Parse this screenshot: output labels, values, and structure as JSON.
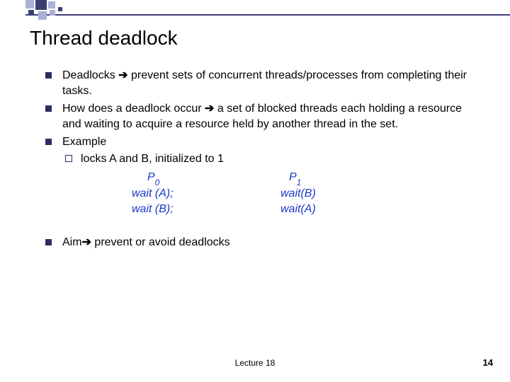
{
  "title": "Thread deadlock",
  "bullets": {
    "b1_a": "Deadlocks ",
    "b1_b": "  prevent sets of concurrent threads/processes from completing their tasks.",
    "b2_a": "How does a deadlock occur ",
    "b2_b": " a set of blocked threads each holding a resource and waiting to acquire a resource held by another thread in the set.",
    "b3": "Example",
    "b3_sub": "locks A and B, initialized to 1",
    "aim_a": "Aim",
    "aim_b": " prevent or avoid deadlocks"
  },
  "arrow": "➔",
  "code": {
    "p0": {
      "label_pre": "P",
      "label_sub": "0",
      "l1": "wait (A);",
      "l2": "wait (B);"
    },
    "p1": {
      "label_pre": "P",
      "label_sub": "1",
      "l1": "wait(B)",
      "l2": "wait(A)"
    }
  },
  "footer": {
    "center": "Lecture 18",
    "right": "14"
  }
}
